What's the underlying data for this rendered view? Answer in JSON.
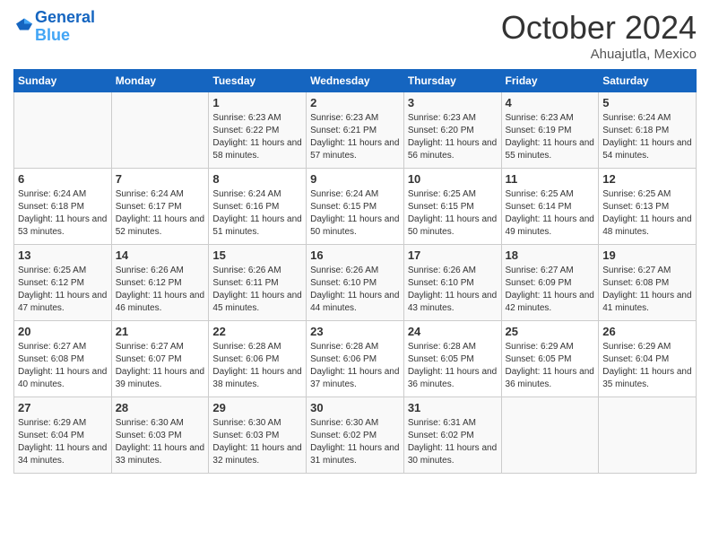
{
  "header": {
    "logo_general": "General",
    "logo_blue": "Blue",
    "month": "October 2024",
    "location": "Ahuajutla, Mexico"
  },
  "days_of_week": [
    "Sunday",
    "Monday",
    "Tuesday",
    "Wednesday",
    "Thursday",
    "Friday",
    "Saturday"
  ],
  "weeks": [
    [
      {
        "day": "",
        "info": ""
      },
      {
        "day": "",
        "info": ""
      },
      {
        "day": "1",
        "info": "Sunrise: 6:23 AM\nSunset: 6:22 PM\nDaylight: 11 hours and 58 minutes."
      },
      {
        "day": "2",
        "info": "Sunrise: 6:23 AM\nSunset: 6:21 PM\nDaylight: 11 hours and 57 minutes."
      },
      {
        "day": "3",
        "info": "Sunrise: 6:23 AM\nSunset: 6:20 PM\nDaylight: 11 hours and 56 minutes."
      },
      {
        "day": "4",
        "info": "Sunrise: 6:23 AM\nSunset: 6:19 PM\nDaylight: 11 hours and 55 minutes."
      },
      {
        "day": "5",
        "info": "Sunrise: 6:24 AM\nSunset: 6:18 PM\nDaylight: 11 hours and 54 minutes."
      }
    ],
    [
      {
        "day": "6",
        "info": "Sunrise: 6:24 AM\nSunset: 6:18 PM\nDaylight: 11 hours and 53 minutes."
      },
      {
        "day": "7",
        "info": "Sunrise: 6:24 AM\nSunset: 6:17 PM\nDaylight: 11 hours and 52 minutes."
      },
      {
        "day": "8",
        "info": "Sunrise: 6:24 AM\nSunset: 6:16 PM\nDaylight: 11 hours and 51 minutes."
      },
      {
        "day": "9",
        "info": "Sunrise: 6:24 AM\nSunset: 6:15 PM\nDaylight: 11 hours and 50 minutes."
      },
      {
        "day": "10",
        "info": "Sunrise: 6:25 AM\nSunset: 6:15 PM\nDaylight: 11 hours and 50 minutes."
      },
      {
        "day": "11",
        "info": "Sunrise: 6:25 AM\nSunset: 6:14 PM\nDaylight: 11 hours and 49 minutes."
      },
      {
        "day": "12",
        "info": "Sunrise: 6:25 AM\nSunset: 6:13 PM\nDaylight: 11 hours and 48 minutes."
      }
    ],
    [
      {
        "day": "13",
        "info": "Sunrise: 6:25 AM\nSunset: 6:12 PM\nDaylight: 11 hours and 47 minutes."
      },
      {
        "day": "14",
        "info": "Sunrise: 6:26 AM\nSunset: 6:12 PM\nDaylight: 11 hours and 46 minutes."
      },
      {
        "day": "15",
        "info": "Sunrise: 6:26 AM\nSunset: 6:11 PM\nDaylight: 11 hours and 45 minutes."
      },
      {
        "day": "16",
        "info": "Sunrise: 6:26 AM\nSunset: 6:10 PM\nDaylight: 11 hours and 44 minutes."
      },
      {
        "day": "17",
        "info": "Sunrise: 6:26 AM\nSunset: 6:10 PM\nDaylight: 11 hours and 43 minutes."
      },
      {
        "day": "18",
        "info": "Sunrise: 6:27 AM\nSunset: 6:09 PM\nDaylight: 11 hours and 42 minutes."
      },
      {
        "day": "19",
        "info": "Sunrise: 6:27 AM\nSunset: 6:08 PM\nDaylight: 11 hours and 41 minutes."
      }
    ],
    [
      {
        "day": "20",
        "info": "Sunrise: 6:27 AM\nSunset: 6:08 PM\nDaylight: 11 hours and 40 minutes."
      },
      {
        "day": "21",
        "info": "Sunrise: 6:27 AM\nSunset: 6:07 PM\nDaylight: 11 hours and 39 minutes."
      },
      {
        "day": "22",
        "info": "Sunrise: 6:28 AM\nSunset: 6:06 PM\nDaylight: 11 hours and 38 minutes."
      },
      {
        "day": "23",
        "info": "Sunrise: 6:28 AM\nSunset: 6:06 PM\nDaylight: 11 hours and 37 minutes."
      },
      {
        "day": "24",
        "info": "Sunrise: 6:28 AM\nSunset: 6:05 PM\nDaylight: 11 hours and 36 minutes."
      },
      {
        "day": "25",
        "info": "Sunrise: 6:29 AM\nSunset: 6:05 PM\nDaylight: 11 hours and 36 minutes."
      },
      {
        "day": "26",
        "info": "Sunrise: 6:29 AM\nSunset: 6:04 PM\nDaylight: 11 hours and 35 minutes."
      }
    ],
    [
      {
        "day": "27",
        "info": "Sunrise: 6:29 AM\nSunset: 6:04 PM\nDaylight: 11 hours and 34 minutes."
      },
      {
        "day": "28",
        "info": "Sunrise: 6:30 AM\nSunset: 6:03 PM\nDaylight: 11 hours and 33 minutes."
      },
      {
        "day": "29",
        "info": "Sunrise: 6:30 AM\nSunset: 6:03 PM\nDaylight: 11 hours and 32 minutes."
      },
      {
        "day": "30",
        "info": "Sunrise: 6:30 AM\nSunset: 6:02 PM\nDaylight: 11 hours and 31 minutes."
      },
      {
        "day": "31",
        "info": "Sunrise: 6:31 AM\nSunset: 6:02 PM\nDaylight: 11 hours and 30 minutes."
      },
      {
        "day": "",
        "info": ""
      },
      {
        "day": "",
        "info": ""
      }
    ]
  ]
}
